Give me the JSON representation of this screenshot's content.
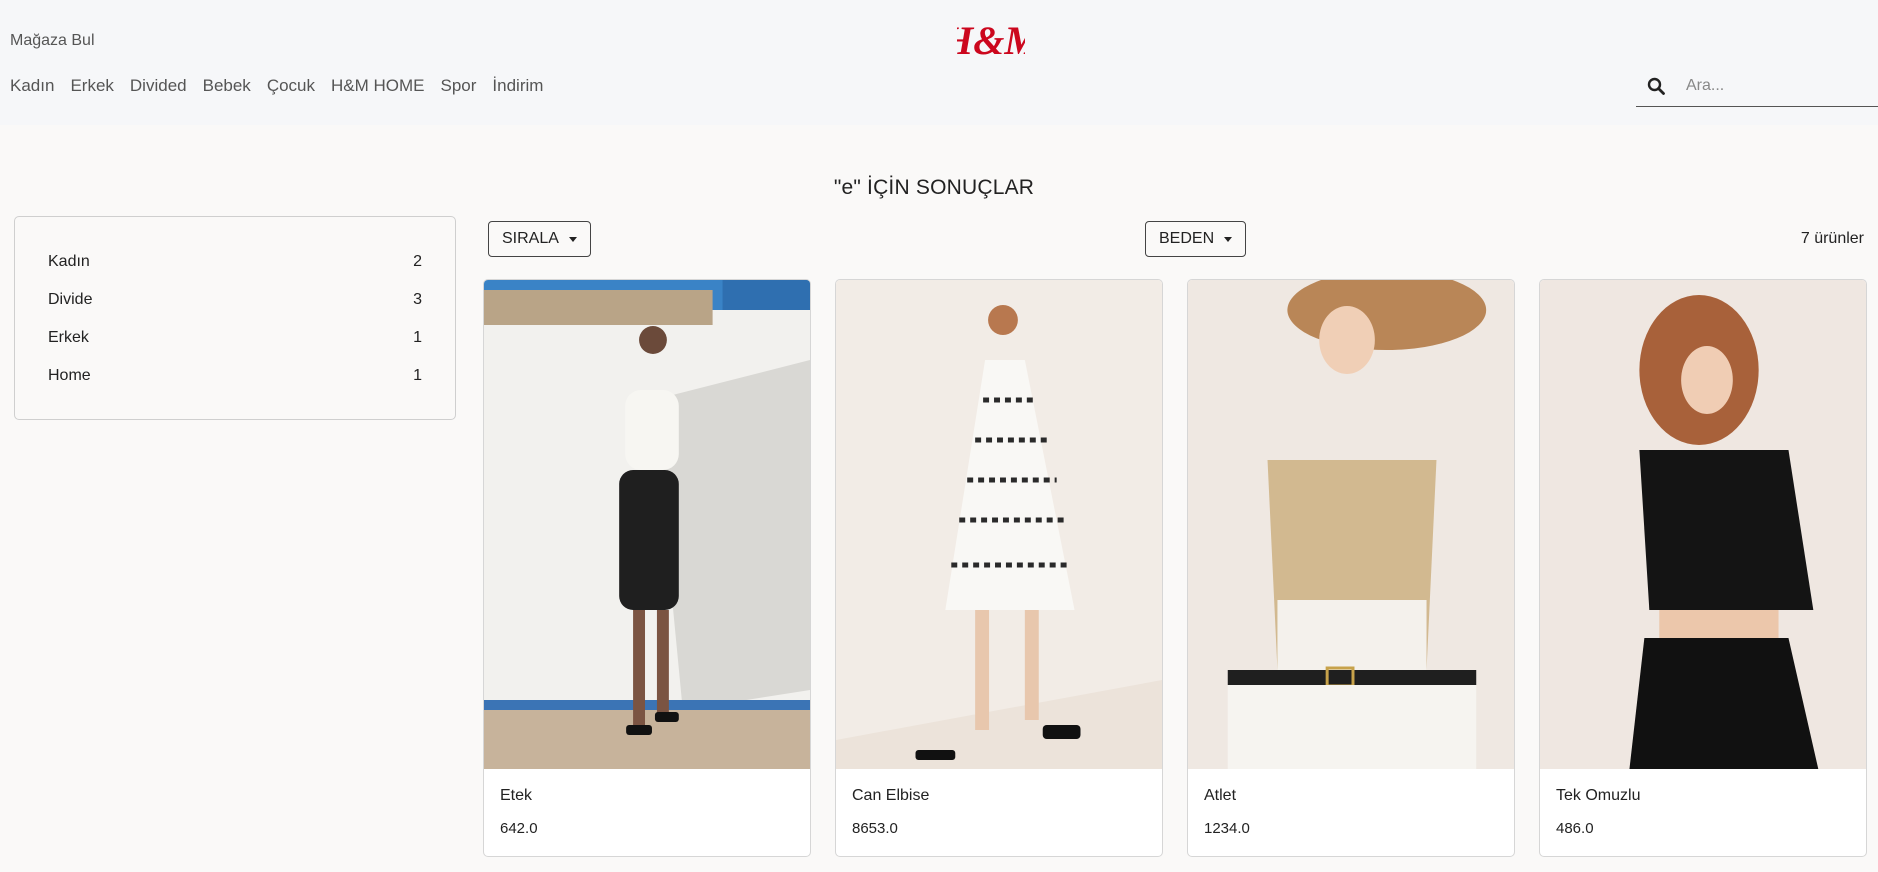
{
  "header": {
    "store_link": "Mağaza Bul",
    "logo_text": "H&M",
    "nav": [
      "Kadın",
      "Erkek",
      "Divided",
      "Bebek",
      "Çocuk",
      "H&M HOME",
      "Spor",
      "İndirim"
    ],
    "search_placeholder": "Ara..."
  },
  "results_title": "\"e\" İÇİN SONUÇLAR",
  "sidebar": {
    "categories": [
      {
        "label": "Kadın",
        "count": "2"
      },
      {
        "label": "Divide",
        "count": "3"
      },
      {
        "label": "Erkek",
        "count": "1"
      },
      {
        "label": "Home",
        "count": "1"
      }
    ]
  },
  "toolbar": {
    "sort_label": "SIRALA",
    "size_label": "BEDEN",
    "count_label": "7 ürünler"
  },
  "products": [
    {
      "name": "Etek",
      "price": "642.0"
    },
    {
      "name": "Can Elbise",
      "price": "8653.0"
    },
    {
      "name": "Atlet",
      "price": "1234.0"
    },
    {
      "name": "Tek Omuzlu",
      "price": "486.0"
    }
  ],
  "colors": {
    "brand_red": "#cc071e",
    "header_bg": "#f6f7f9",
    "page_bg": "#faf9f8"
  },
  "icons": [
    "search-icon",
    "caret-down-icon"
  ]
}
